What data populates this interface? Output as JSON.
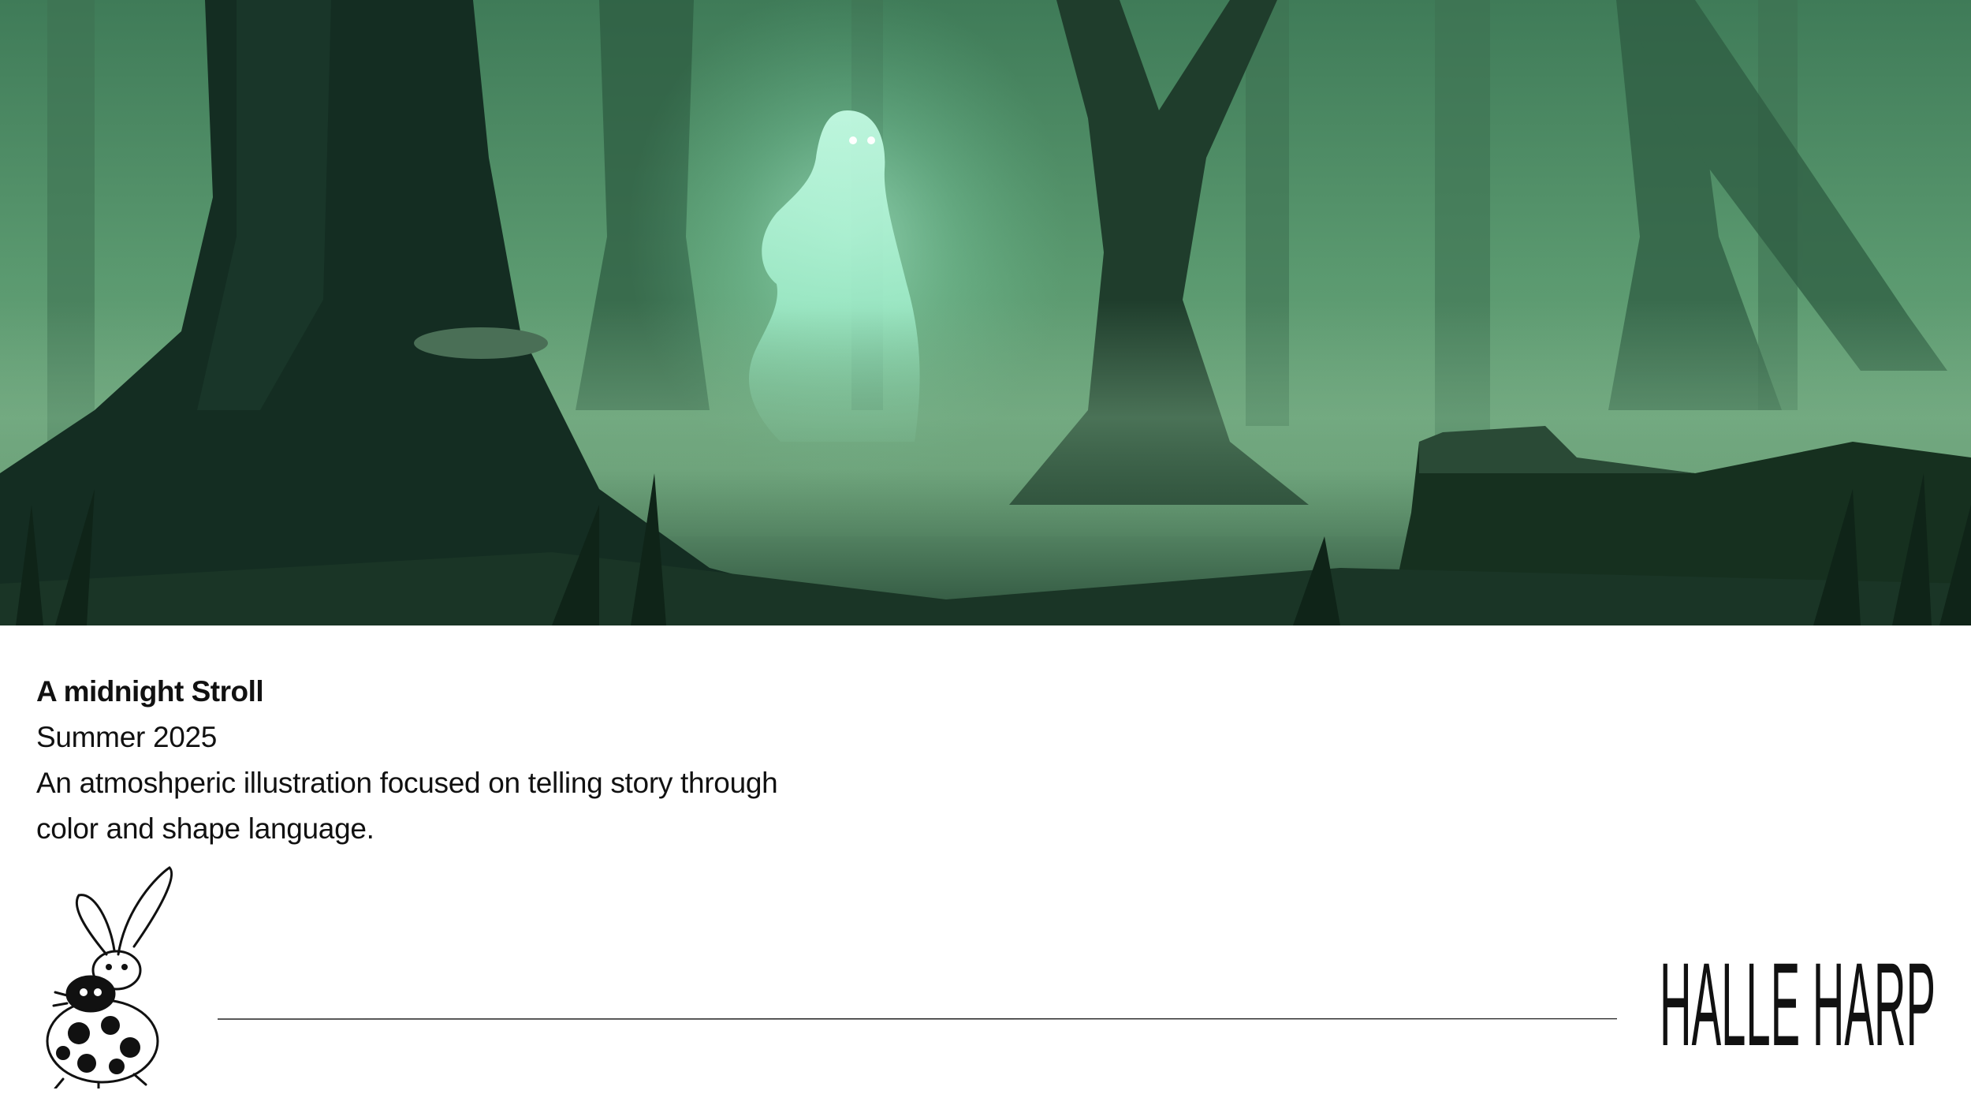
{
  "artwork": {
    "title": "A midnight Stroll",
    "date": "Summer 2025",
    "description_line1": "An atmoshperic illustration focused on telling story through",
    "description_line2": "color and shape language."
  },
  "footer": {
    "signature": "HALLE HARP",
    "mascot_icon": "ladybug-bunny-icon"
  },
  "colors": {
    "forest_light": "#4f8a63",
    "forest_mid": "#2f5e45",
    "forest_dark": "#12281d",
    "ghost": "#a8f0cf",
    "text": "#111111"
  }
}
